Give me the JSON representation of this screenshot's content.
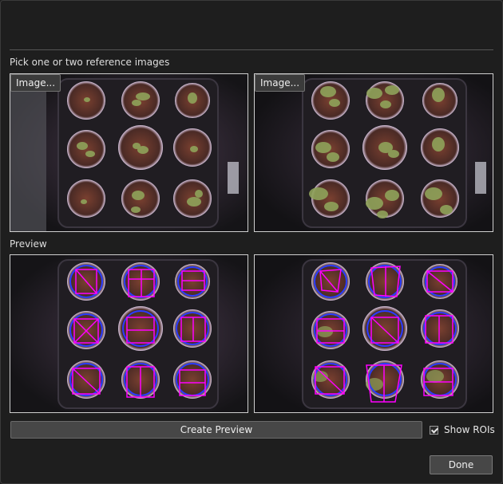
{
  "dialog": {
    "reference_label": "Pick one or two reference images",
    "preview_label": "Preview",
    "image_button_left": "Image...",
    "image_button_right": "Image...",
    "create_preview_label": "Create Preview",
    "show_rois_label": "Show ROIs",
    "show_rois_checked": true,
    "done_label": "Done"
  },
  "colors": {
    "background": "#1e1e1e",
    "roi_magenta": "#ff00ff",
    "roi_blue": "#2a3cff",
    "soil": "#6e3a2c",
    "plant_green": "#8fa35a"
  }
}
